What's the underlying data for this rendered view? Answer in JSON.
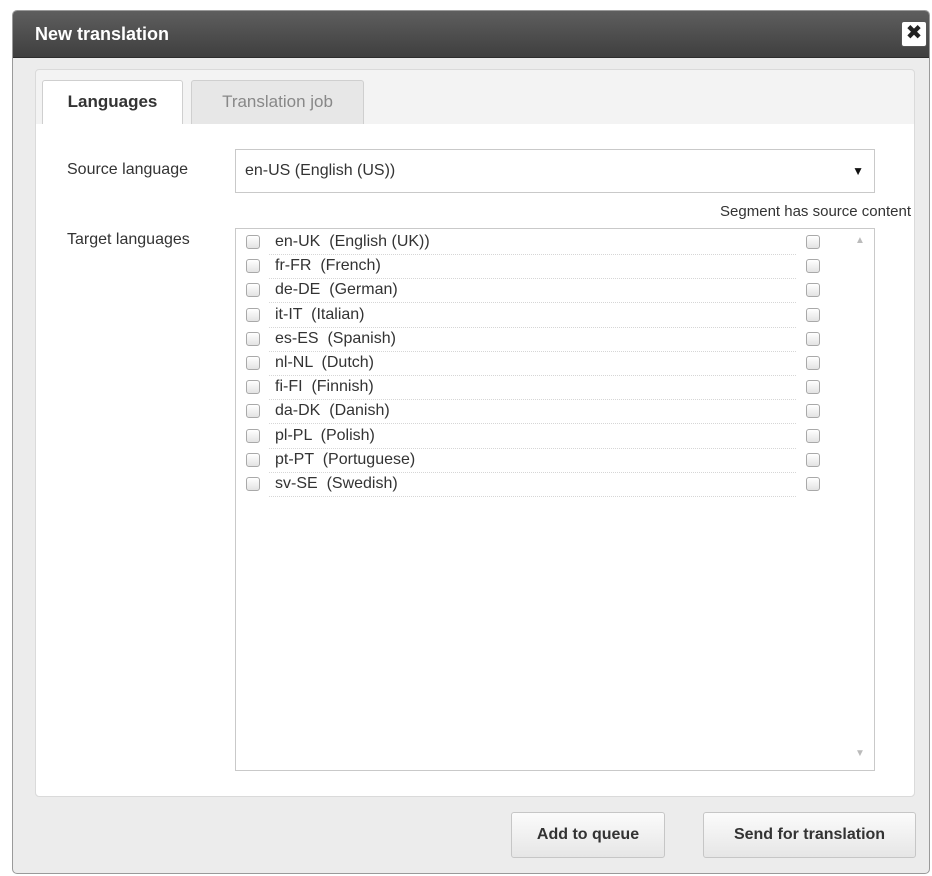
{
  "dialog": {
    "title": "New translation",
    "close_label": "✖"
  },
  "tabs": [
    {
      "label": "Languages",
      "active": true
    },
    {
      "label": "Translation job",
      "active": false
    }
  ],
  "form": {
    "source_label": "Source language",
    "source_value": "en-US  (English (US))",
    "dropdown_arrow": "▼",
    "target_label": "Target languages",
    "segment_header": "Segment has source content"
  },
  "target_languages": [
    {
      "label": "en-UK  (English (UK))",
      "checked": false,
      "has_source": false
    },
    {
      "label": "fr-FR  (French)",
      "checked": false,
      "has_source": false
    },
    {
      "label": "de-DE  (German)",
      "checked": false,
      "has_source": false
    },
    {
      "label": "it-IT  (Italian)",
      "checked": false,
      "has_source": false
    },
    {
      "label": "es-ES  (Spanish)",
      "checked": false,
      "has_source": false
    },
    {
      "label": "nl-NL  (Dutch)",
      "checked": false,
      "has_source": false
    },
    {
      "label": "fi-FI  (Finnish)",
      "checked": false,
      "has_source": false
    },
    {
      "label": "da-DK  (Danish)",
      "checked": false,
      "has_source": false
    },
    {
      "label": "pl-PL  (Polish)",
      "checked": false,
      "has_source": false
    },
    {
      "label": "pt-PT  (Portuguese)",
      "checked": false,
      "has_source": false
    },
    {
      "label": "sv-SE  (Swedish)",
      "checked": false,
      "has_source": false
    }
  ],
  "scroll": {
    "up_icon": "▲",
    "down_icon": "▼"
  },
  "buttons": {
    "add_to_queue": "Add to queue",
    "send_for_translation": "Send for translation"
  },
  "colors": {
    "titlebar": "#4a4a4a",
    "panel_bg": "#ececec",
    "content_bg": "#ffffff"
  }
}
